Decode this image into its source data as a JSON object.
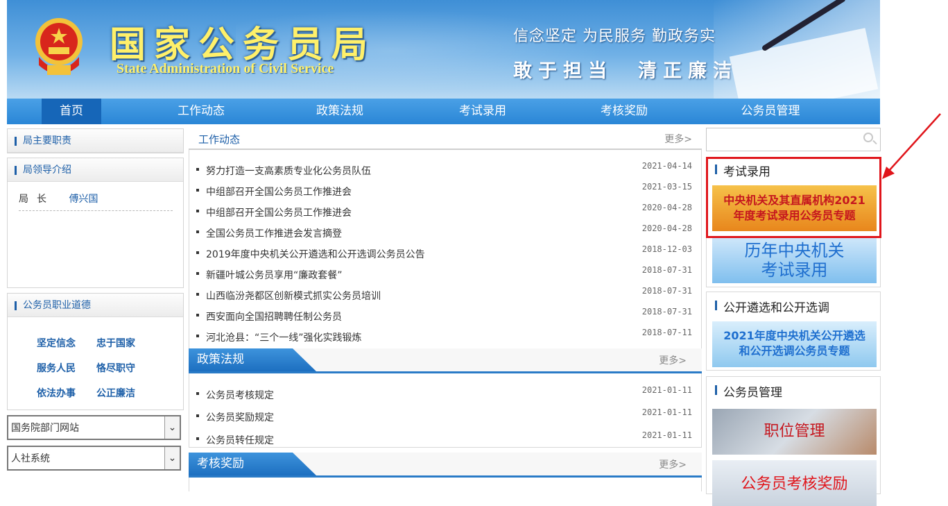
{
  "header": {
    "title_cn": "国家公务员局",
    "title_en": "State Administration of Civil Service",
    "slogan_line1": "信念坚定 为民服务 勤政务实",
    "slogan_line2": "敢于担当　清正廉洁"
  },
  "nav": {
    "items": [
      {
        "label": "首页",
        "active": true
      },
      {
        "label": "工作动态"
      },
      {
        "label": "政策法规"
      },
      {
        "label": "考试录用"
      },
      {
        "label": "考核奖励"
      },
      {
        "label": "公务员管理"
      }
    ]
  },
  "left": {
    "duties_title": "局主要职责",
    "leaders_title": "局领导介绍",
    "leader_position": "局长",
    "leader_name": "傅兴国",
    "ethics_title": "公务员职业道德",
    "ethics": [
      "坚定信念",
      "忠于国家",
      "服务人民",
      "恪尽职守",
      "依法办事",
      "公正廉洁"
    ],
    "select1": "国务院部门网站",
    "select2": "人社系统",
    "select_arrow": "⌄"
  },
  "work": {
    "title": "工作动态",
    "more": "更多>",
    "items": [
      {
        "text": "努力打造一支高素质专业化公务员队伍",
        "date": "2021-04-14"
      },
      {
        "text": "中组部召开全国公务员工作推进会",
        "date": "2021-03-15"
      },
      {
        "text": "中组部召开全国公务员工作推进会",
        "date": "2020-04-28"
      },
      {
        "text": "全国公务员工作推进会发言摘登",
        "date": "2020-04-28"
      },
      {
        "text": "2019年度中央机关公开遴选和公开选调公务员公告",
        "date": "2018-12-03"
      },
      {
        "text": "新疆叶城公务员享用“廉政套餐”",
        "date": "2018-07-31"
      },
      {
        "text": "山西临汾尧都区创新模式抓实公务员培训",
        "date": "2018-07-31"
      },
      {
        "text": "西安面向全国招聘聘任制公务员",
        "date": "2018-07-31"
      },
      {
        "text": "河北沧县：“三个一线”强化实践锻炼",
        "date": "2018-07-11"
      }
    ]
  },
  "policy": {
    "title": "政策法规",
    "more": "更多>",
    "items": [
      {
        "text": "公务员考核规定",
        "date": "2021-01-11"
      },
      {
        "text": "公务员奖励规定",
        "date": "2021-01-11"
      },
      {
        "text": "公务员转任规定",
        "date": "2021-01-11"
      }
    ]
  },
  "assess": {
    "title": "考核奖励",
    "more": "更多>"
  },
  "right": {
    "exam_title": "考试录用",
    "exam_banner1": "中央机关及其直属机构2021年度考试录用公务员专题",
    "exam_banner1_line1": "中央机关及其直属机构2021",
    "exam_banner1_line2": "年度考试录用公务员专题",
    "exam_banner2_line1": "历年中央机关",
    "exam_banner2_line2": "考试录用",
    "select_title": "公开遴选和公开选调",
    "select_banner_line1": "2021年度中央机关公开遴选",
    "select_banner_line2": "和公开选调公务员专题",
    "mgmt_title": "公务员管理",
    "mgmt_banner1": "职位管理",
    "mgmt_banner2": "公务员考核奖励"
  },
  "colors": {
    "nav_bg": "#2a86d6",
    "nav_active": "#1666b8",
    "link_blue": "#1d5fa8",
    "highlight_red": "#e0151b"
  }
}
